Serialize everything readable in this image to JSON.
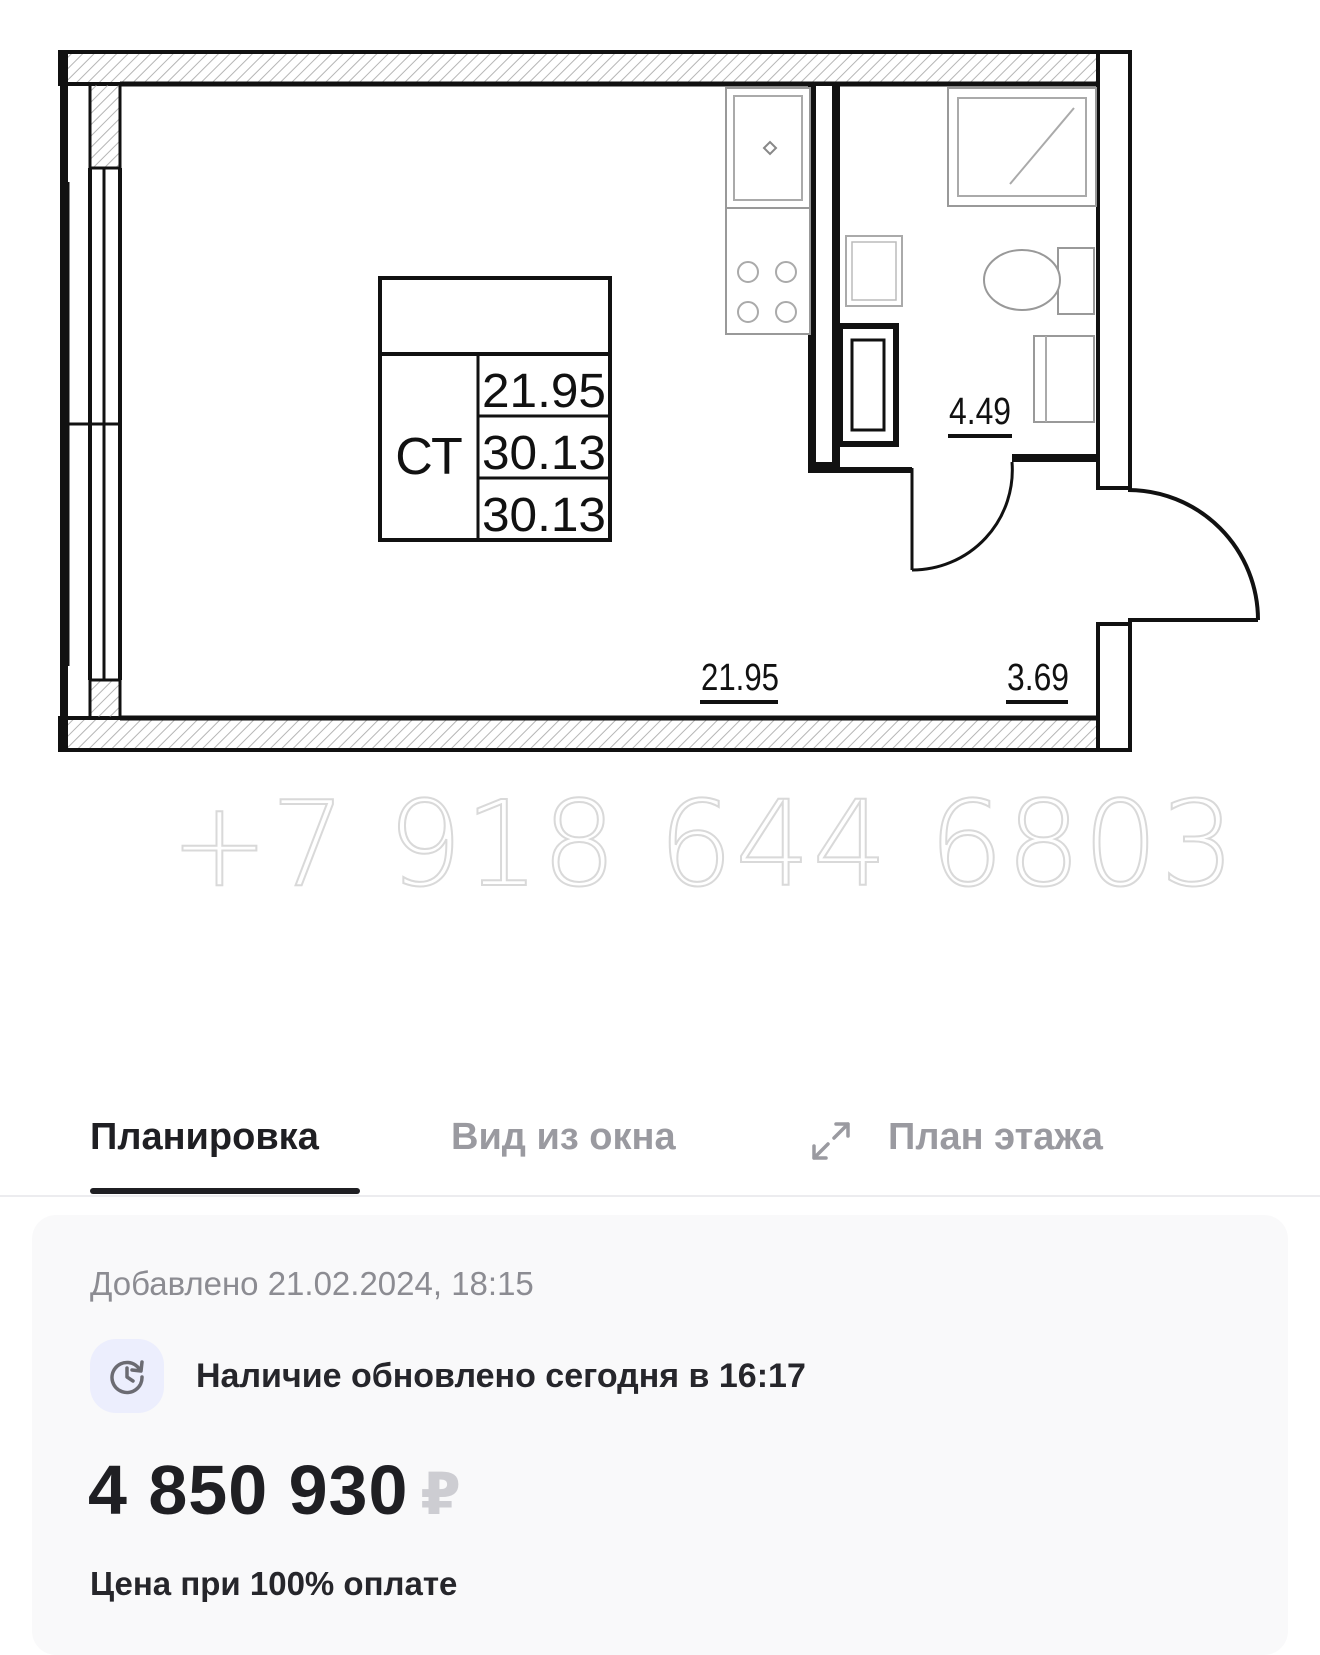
{
  "floorplan": {
    "room_code": "СТ",
    "table_values": [
      "21.95",
      "30.13",
      "30.13"
    ],
    "room_area": "21.95",
    "bathroom_area": "4.49",
    "hall_area": "3.69"
  },
  "watermark": "+7 918 644 6803",
  "tabs": {
    "layout": "Планировка",
    "window_view": "Вид из окна",
    "floor_plan": "План этажа"
  },
  "listing": {
    "added": "Добавлено 21.02.2024, 18:15",
    "availability": "Наличие обновлено сегодня в 16:17",
    "price": "4 850 930",
    "currency": "₽",
    "price_note": "Цена при 100% оплате"
  },
  "icons": {
    "expand": "expand-icon",
    "availability": "clock-refresh-icon"
  },
  "colors": {
    "text_primary": "#1f1f23",
    "text_muted": "#9a9aa0",
    "card_bg": "#f9f9fa",
    "icon_bg": "#eceefd",
    "currency": "#cdcdd2"
  }
}
